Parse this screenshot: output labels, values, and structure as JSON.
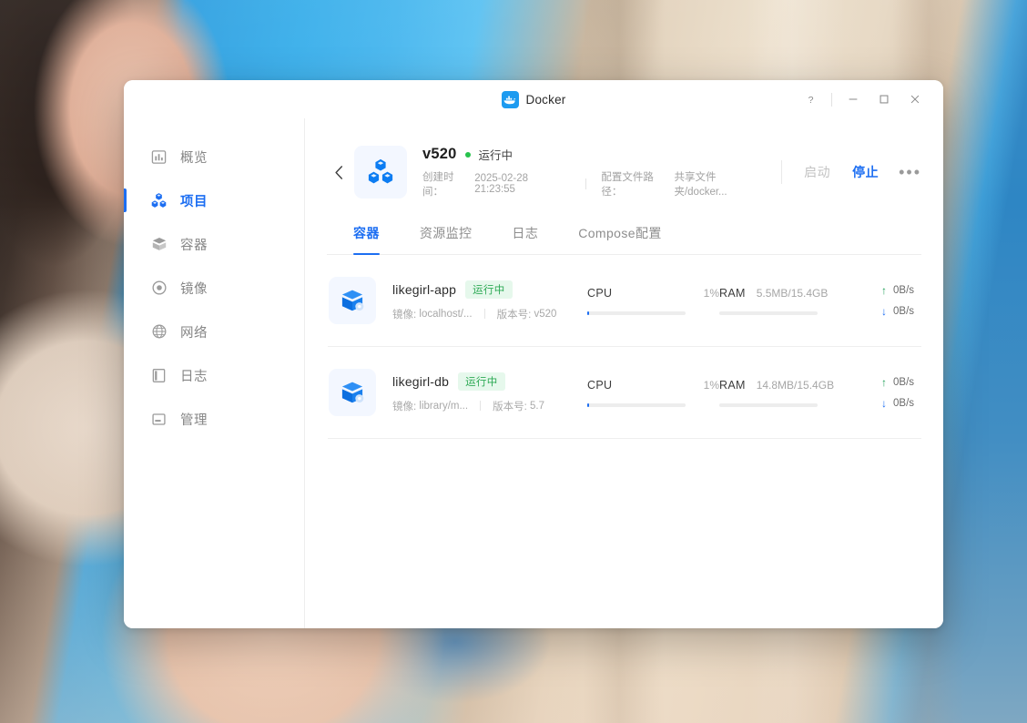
{
  "window": {
    "title": "Docker",
    "logo_icon": "docker-whale-icon",
    "controls": {
      "help": "?",
      "minimize": "—",
      "maximize": "▢",
      "close": "✕"
    }
  },
  "sidebar": {
    "items": [
      {
        "label": "概览",
        "icon": "chart-overview-icon",
        "active": false
      },
      {
        "label": "项目",
        "icon": "cubes-project-icon",
        "active": true
      },
      {
        "label": "容器",
        "icon": "container-box-icon",
        "active": false
      },
      {
        "label": "镜像",
        "icon": "disc-image-icon",
        "active": false
      },
      {
        "label": "网络",
        "icon": "globe-network-icon",
        "active": false
      },
      {
        "label": "日志",
        "icon": "book-log-icon",
        "active": false
      },
      {
        "label": "管理",
        "icon": "window-manage-icon",
        "active": false
      }
    ]
  },
  "project": {
    "back_icon": "chevron-left-icon",
    "avatar_icon": "cubes-project-icon",
    "name": "v520",
    "status": "运行中",
    "status_color": "#27c24c",
    "created_label": "创建时间：",
    "created_value": "2025-02-28 21:23:55",
    "config_label": "配置文件路径：",
    "config_value": "共享文件夹/docker...",
    "actions": {
      "start": "启动",
      "stop": "停止",
      "more": "•••"
    }
  },
  "tabs": [
    {
      "label": "容器",
      "active": true
    },
    {
      "label": "资源监控",
      "active": false
    },
    {
      "label": "日志",
      "active": false
    },
    {
      "label": "Compose配置",
      "active": false
    }
  ],
  "containers": [
    {
      "icon": "container-box-icon",
      "name": "likegirl-app",
      "status": "运行中",
      "image_label": "镜像:",
      "image_value": "localhost/...",
      "version_label": "版本号:",
      "version_value": "v520",
      "cpu_label": "CPU",
      "cpu_value": "1%",
      "cpu_percent": 2,
      "ram_label": "RAM",
      "ram_value": "5.5MB/15.4GB",
      "ram_percent": 0,
      "net_up": "0B/s",
      "net_down": "0B/s"
    },
    {
      "icon": "container-box-icon",
      "name": "likegirl-db",
      "status": "运行中",
      "image_label": "镜像:",
      "image_value": "library/m...",
      "version_label": "版本号:",
      "version_value": "5.7",
      "cpu_label": "CPU",
      "cpu_value": "1%",
      "cpu_percent": 2,
      "ram_label": "RAM",
      "ram_value": "14.8MB/15.4GB",
      "ram_percent": 0,
      "net_up": "0B/s",
      "net_down": "0B/s"
    }
  ],
  "colors": {
    "accent": "#1c6ef2",
    "running_green": "#2eaa55",
    "badge_bg": "#e6f8ec",
    "muted": "#a6a6a6"
  }
}
